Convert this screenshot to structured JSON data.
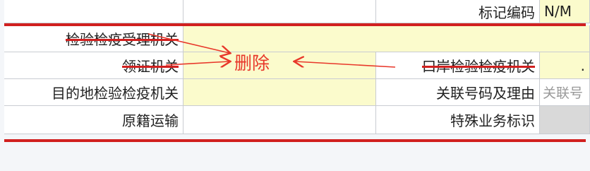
{
  "form": {
    "rows": [
      {
        "label": "标记编码",
        "value": "N/M"
      },
      {
        "label": "检验检疫受理机关",
        "value": ""
      },
      {
        "label": "领证机关",
        "value": "",
        "right_label": "口岸检验检疫机关",
        "right_value": "."
      },
      {
        "label": "目的地检验检疫机关",
        "value": "",
        "right_label": "关联号码及理由",
        "right_value": "关联号"
      },
      {
        "label": "原籍运输",
        "value": "",
        "right_label": "特殊业务标识",
        "right_value": ""
      }
    ]
  },
  "annotation": {
    "text": "删除",
    "color": "#e8372a"
  }
}
